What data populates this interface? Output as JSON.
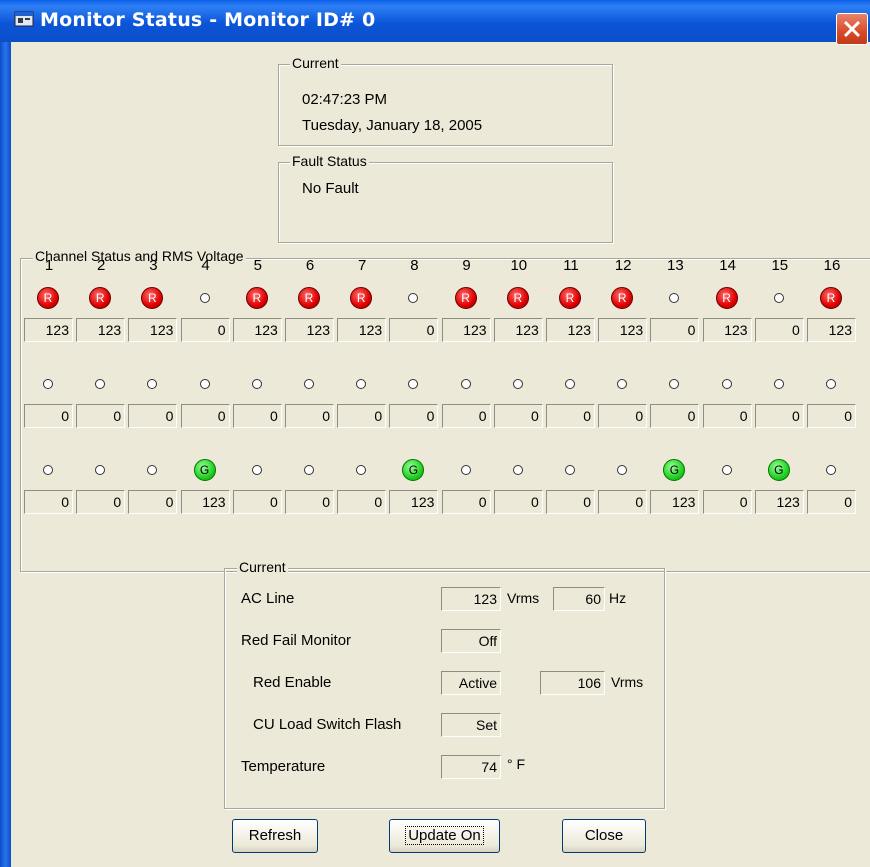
{
  "window": {
    "title": "Monitor Status - Monitor ID# 0",
    "colors": {
      "titlebar": "#0a55d8",
      "face": "#ece9d8",
      "close": "#d94a28"
    }
  },
  "current_time": {
    "group_label": "Current",
    "time": "02:47:23 PM",
    "date": "Tuesday, January 18, 2005"
  },
  "fault": {
    "group_label": "Fault Status",
    "value": "No Fault"
  },
  "channels": {
    "group_label": "Channel Status and RMS Voltage",
    "numbers": [
      "1",
      "2",
      "3",
      "4",
      "5",
      "6",
      "7",
      "8",
      "9",
      "10",
      "11",
      "12",
      "13",
      "14",
      "15",
      "16"
    ],
    "rows": [
      {
        "lamps": [
          "R",
          "R",
          "R",
          "O",
          "R",
          "R",
          "R",
          "O",
          "R",
          "R",
          "R",
          "R",
          "O",
          "R",
          "O",
          "R"
        ],
        "values": [
          "123",
          "123",
          "123",
          "0",
          "123",
          "123",
          "123",
          "0",
          "123",
          "123",
          "123",
          "123",
          "0",
          "123",
          "0",
          "123"
        ]
      },
      {
        "lamps": [
          "O",
          "O",
          "O",
          "O",
          "O",
          "O",
          "O",
          "O",
          "O",
          "O",
          "O",
          "O",
          "O",
          "O",
          "O",
          "O"
        ],
        "values": [
          "0",
          "0",
          "0",
          "0",
          "0",
          "0",
          "0",
          "0",
          "0",
          "0",
          "0",
          "0",
          "0",
          "0",
          "0",
          "0"
        ]
      },
      {
        "lamps": [
          "O",
          "O",
          "O",
          "G",
          "O",
          "O",
          "O",
          "G",
          "O",
          "O",
          "O",
          "O",
          "G",
          "O",
          "G",
          "O"
        ],
        "values": [
          "0",
          "0",
          "0",
          "123",
          "0",
          "0",
          "0",
          "123",
          "0",
          "0",
          "0",
          "0",
          "123",
          "0",
          "123",
          "0"
        ]
      }
    ]
  },
  "current_status": {
    "group_label": "Current",
    "ac_line": {
      "label": "AC Line",
      "voltage": "123",
      "voltage_unit": "Vrms",
      "frequency": "60",
      "frequency_unit": "Hz"
    },
    "red_fail_monitor": {
      "label": "Red Fail Monitor",
      "value": "Off"
    },
    "red_enable": {
      "label": "Red Enable",
      "value": "Active",
      "voltage": "106",
      "voltage_unit": "Vrms"
    },
    "cu_load_switch_flash": {
      "label": "CU Load Switch Flash",
      "value": "Set"
    },
    "temperature": {
      "label": "Temperature",
      "value": "74",
      "unit": "° F"
    }
  },
  "buttons": {
    "refresh": "Refresh",
    "update": "Update On",
    "close": "Close"
  }
}
